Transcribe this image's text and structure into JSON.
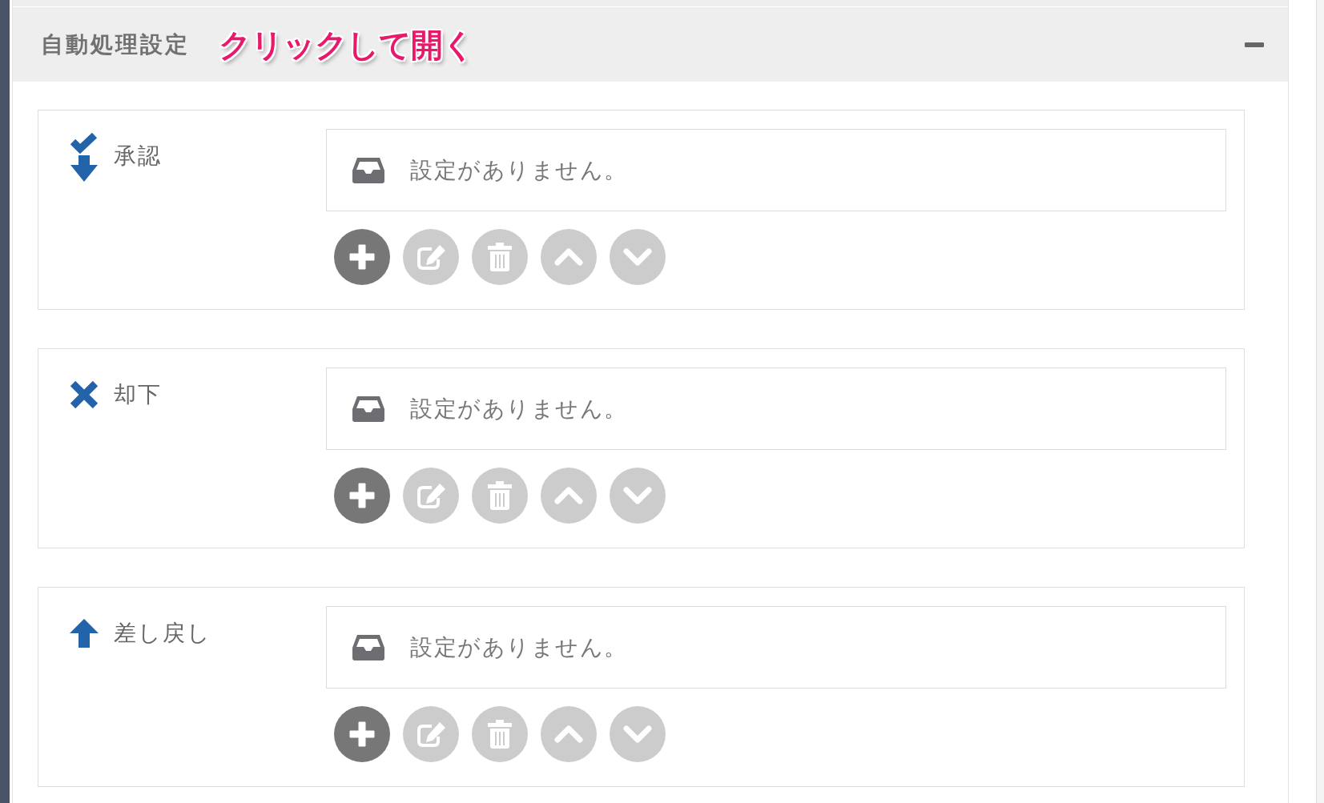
{
  "panel": {
    "title": "自動処理設定",
    "annotation": "クリックして開く",
    "expanded": true
  },
  "sections": [
    {
      "kind": "approve",
      "label": "承認",
      "empty_message": "設定がありません。",
      "buttons": [
        {
          "kind": "add",
          "disabled": false
        },
        {
          "kind": "edit",
          "disabled": true
        },
        {
          "kind": "delete",
          "disabled": true
        },
        {
          "kind": "up",
          "disabled": true
        },
        {
          "kind": "down",
          "disabled": true
        }
      ]
    },
    {
      "kind": "reject",
      "label": "却下",
      "empty_message": "設定がありません。",
      "buttons": [
        {
          "kind": "add",
          "disabled": false
        },
        {
          "kind": "edit",
          "disabled": true
        },
        {
          "kind": "delete",
          "disabled": true
        },
        {
          "kind": "up",
          "disabled": true
        },
        {
          "kind": "down",
          "disabled": true
        }
      ]
    },
    {
      "kind": "return",
      "label": "差し戻し",
      "empty_message": "設定がありません。",
      "buttons": [
        {
          "kind": "add",
          "disabled": false
        },
        {
          "kind": "edit",
          "disabled": true
        },
        {
          "kind": "delete",
          "disabled": true
        },
        {
          "kind": "up",
          "disabled": true
        },
        {
          "kind": "down",
          "disabled": true
        }
      ]
    }
  ]
}
